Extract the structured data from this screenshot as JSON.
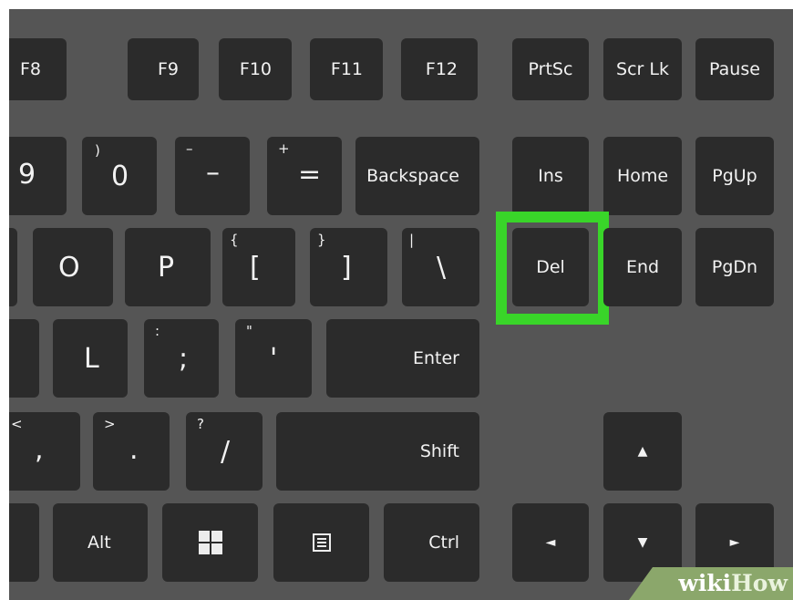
{
  "function_row": {
    "f8": "F8",
    "f9": "F9",
    "f10": "F10",
    "f11": "F11",
    "f12": "F12",
    "prtsc": "PrtSc",
    "scrlk": "Scr Lk",
    "pause": "Pause"
  },
  "number_row": {
    "nine": "9",
    "zero": "0",
    "zero_shift": ")",
    "minus": "–",
    "minus_shift": "–",
    "equals": "=",
    "equals_shift": "+",
    "backspace": "Backspace",
    "ins": "Ins",
    "home": "Home",
    "pgup": "PgUp"
  },
  "top_row": {
    "o": "O",
    "p": "P",
    "bracket_left": "[",
    "bracket_left_shift": "{",
    "bracket_right": "]",
    "bracket_right_shift": "}",
    "backslash": "\\",
    "backslash_shift": "|",
    "del": "Del",
    "end": "End",
    "pgdn": "PgDn"
  },
  "home_row": {
    "l": "L",
    "semicolon": ";",
    "semicolon_shift": ":",
    "quote": "'",
    "quote_shift": "\"",
    "enter": "Enter"
  },
  "bottom_row": {
    "comma": ",",
    "comma_shift": "<",
    "period": ".",
    "period_shift": ">",
    "slash": "/",
    "slash_shift": "?",
    "shift": "Shift",
    "arrow_up": "▲"
  },
  "space_row": {
    "alt": "Alt",
    "ctrl": "Ctrl",
    "arrow_left": "◄",
    "arrow_down": "▼",
    "arrow_right": "►"
  },
  "highlighted_key": "Del",
  "colors": {
    "board": "#555555",
    "key": "#2b2b2b",
    "key_text": "#f2f2f2",
    "highlight": "#39d529",
    "watermark_bg": "#8ba76b"
  },
  "icons": {
    "windows_key": "windows-logo-icon",
    "menu_key": "context-menu-icon"
  },
  "watermark": {
    "prefix": "wiki",
    "suffix": "How"
  }
}
